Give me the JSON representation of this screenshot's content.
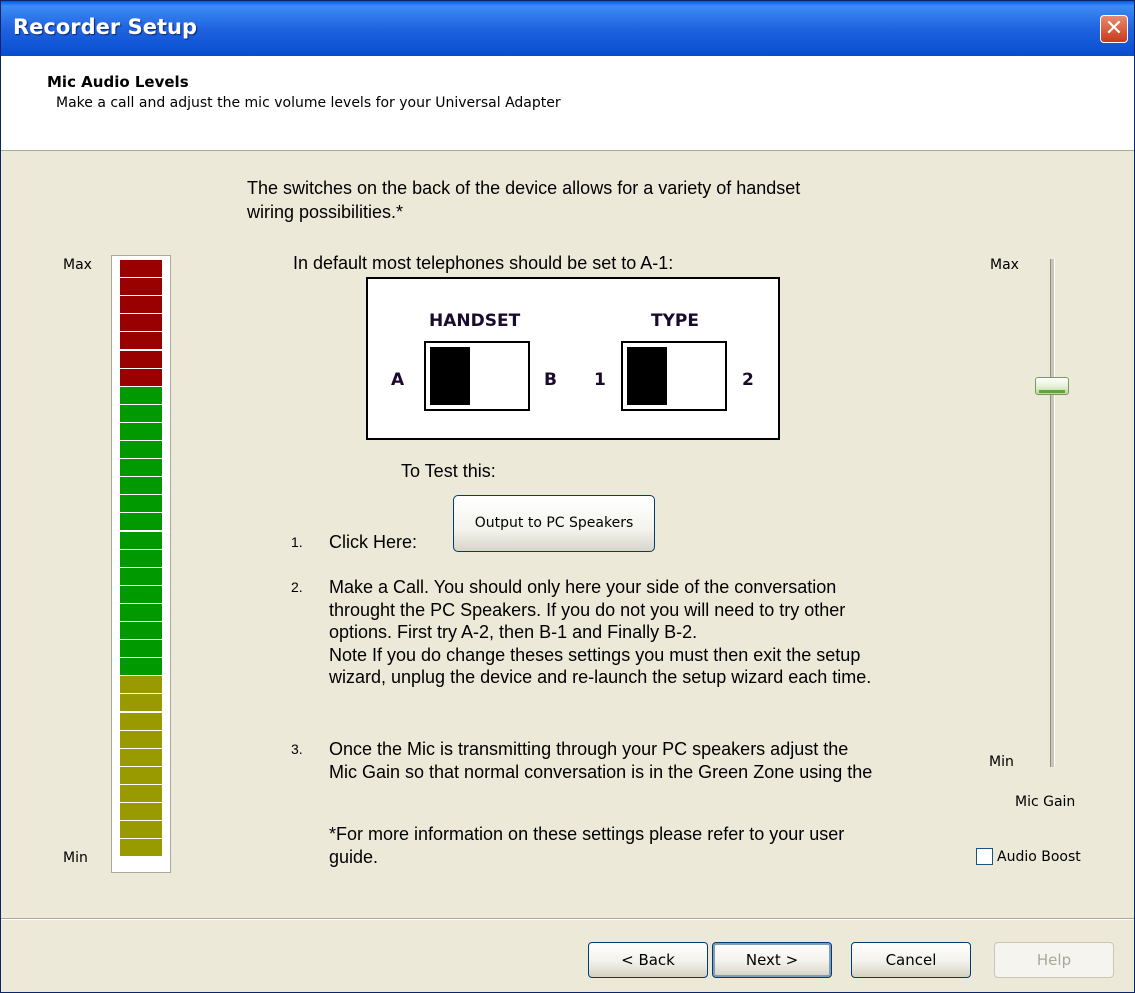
{
  "window": {
    "title": "Recorder Setup",
    "close_glyph": "✕"
  },
  "header": {
    "title": "Mic Audio Levels",
    "subtitle": "Make a call and adjust the mic volume levels for your Universal Adapter"
  },
  "content": {
    "intro_line1": "The switches on the back of the device allows for a variety of handset",
    "intro_line2": "wiring possibilities.*",
    "default_text": "In default most telephones should be set to A-1:",
    "switches": {
      "handset_label": "HANDSET",
      "type_label": "TYPE",
      "a": "A",
      "b": "B",
      "one": "1",
      "two": "2"
    },
    "test_text": "To Test this:",
    "steps": [
      {
        "num": "1.",
        "lines": [
          "Click Here:"
        ]
      },
      {
        "num": "2.",
        "lines": [
          "Make a Call. You should only here your side of the conversation",
          "throught the PC Speakers. If you do not you will need to try other",
          "options. First try A-2, then B-1 and Finally B-2.",
          "Note If you do change theses settings you must then exit the setup",
          "wizard, unplug the device and re-launch the setup wizard each time."
        ]
      },
      {
        "num": "3.",
        "lines": [
          "Once the Mic is transmitting through your PC speakers adjust the",
          "Mic Gain so that normal conversation is in the Green Zone using the"
        ]
      }
    ],
    "footnote_line1": "*For more information on these settings please refer to your user",
    "footnote_line2": "guide.",
    "output_button": "Output to PC Speakers"
  },
  "meter": {
    "max_label": "Max",
    "min_label": "Min",
    "segments": {
      "red": 7,
      "green": 16,
      "yellow": 10
    },
    "colors": {
      "red": "#990000",
      "green": "#009900",
      "yellow": "#999900"
    }
  },
  "slider": {
    "max_label": "Max",
    "min_label": "Min",
    "caption": "Mic Gain",
    "level": 0.76
  },
  "audio_boost": {
    "label": "Audio Boost",
    "checked": false
  },
  "buttons": {
    "back": "< Back",
    "next": "Next >",
    "cancel": "Cancel",
    "help": "Help"
  }
}
